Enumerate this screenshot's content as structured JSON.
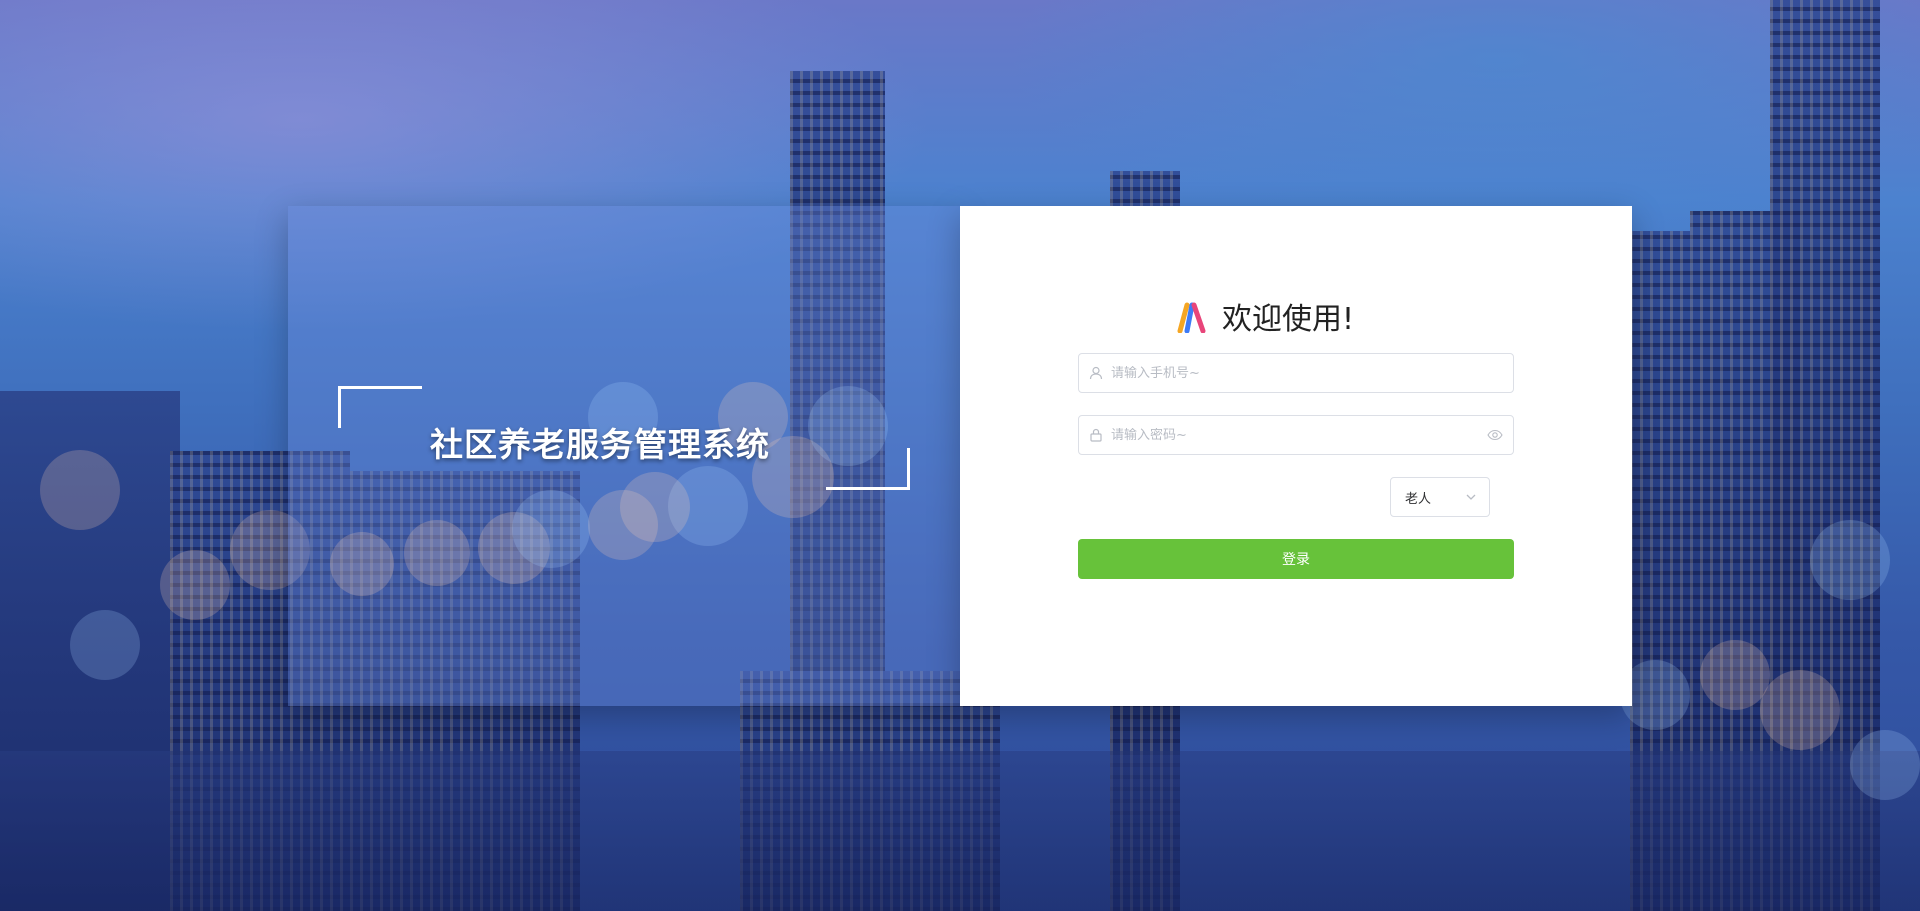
{
  "left_panel": {
    "system_title": "社区养老服务管理系统"
  },
  "login_form": {
    "welcome": "欢迎使用!",
    "phone_placeholder": "请输入手机号~",
    "password_placeholder": "请输入密码~",
    "role_selected": "老人",
    "login_label": "登录"
  },
  "icons": {
    "logo": "app-logo-icon",
    "phone": "user-icon",
    "password": "lock-icon",
    "visibility": "eye-icon",
    "dropdown": "chevron-down-icon"
  },
  "colors": {
    "login_button": "#67c23a",
    "logo_orange": "#f5a623",
    "logo_blue": "#3d7bf7",
    "logo_pink": "#e8457a"
  }
}
